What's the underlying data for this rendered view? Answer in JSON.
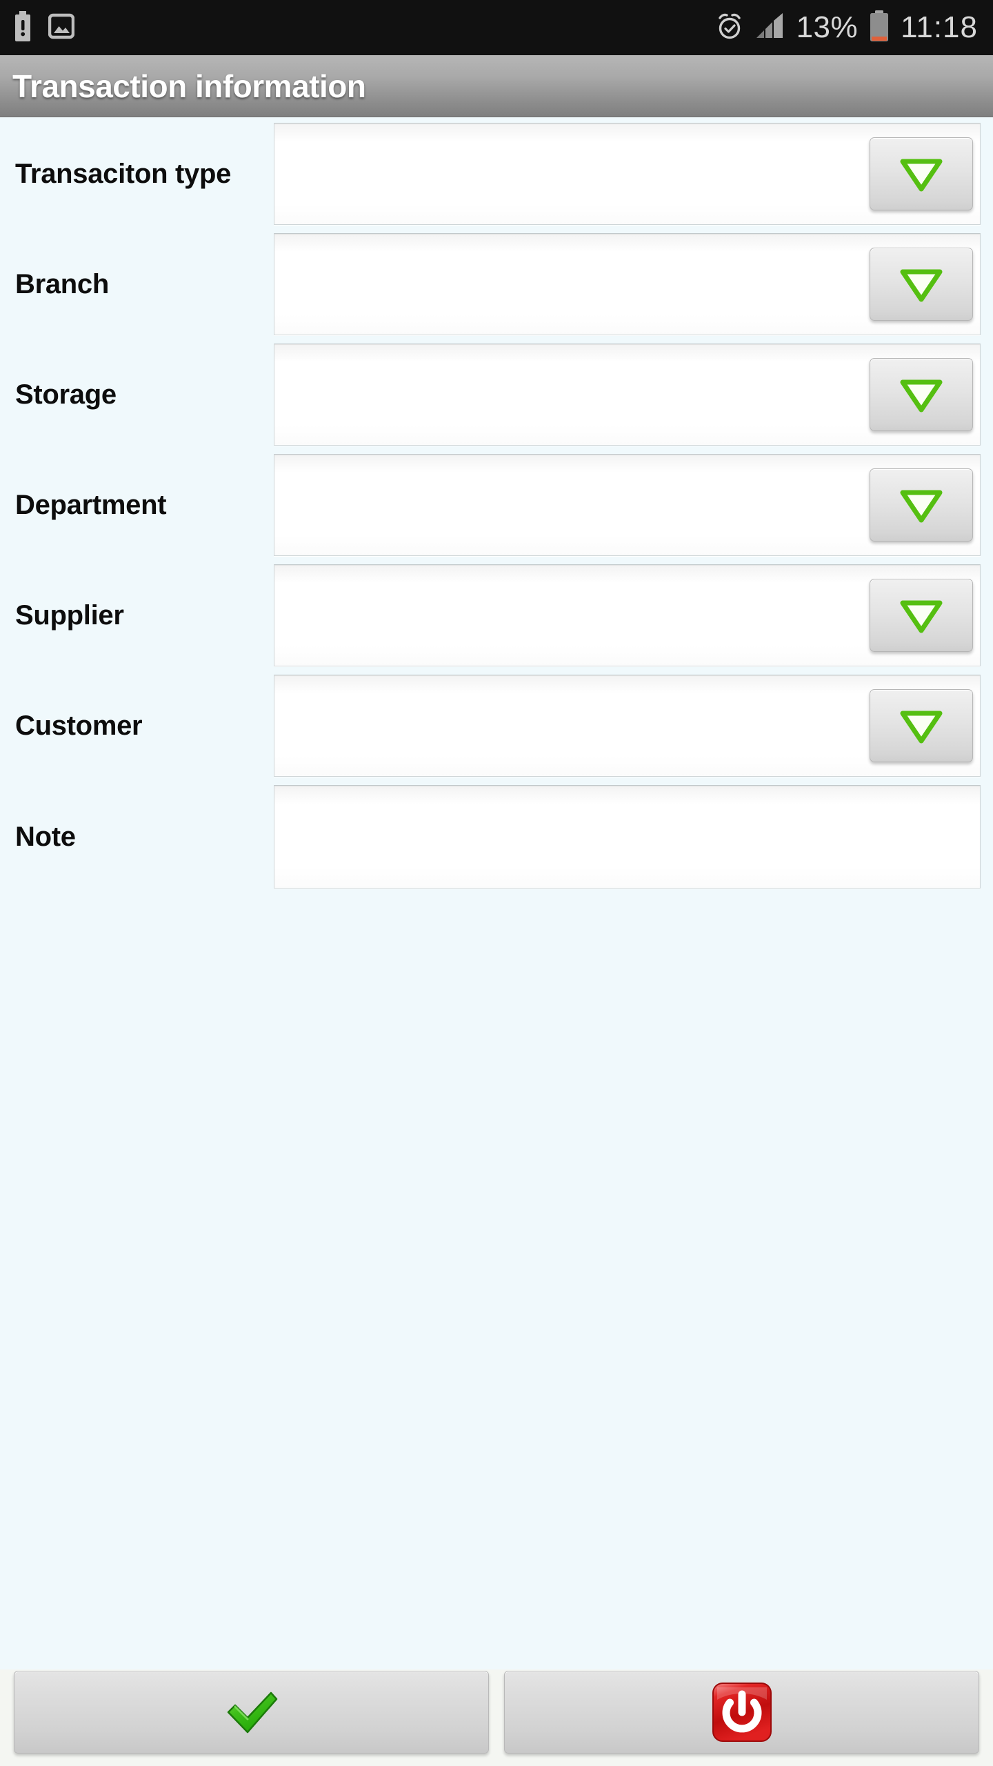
{
  "statusbar": {
    "left_icons": [
      {
        "name": "clipboard-alert-icon"
      },
      {
        "name": "image-icon"
      }
    ],
    "right_icons": [
      {
        "name": "alarm-clock-icon"
      },
      {
        "name": "signal-bars-icon"
      }
    ],
    "battery_percent": "13%",
    "battery_icon": "battery-low-icon",
    "clock": "11:18",
    "bg_color": "#111111",
    "text_color": "#d8d8d8",
    "battery_low_color": "#e0603a"
  },
  "titlebar": {
    "title": "Transaction information",
    "gradient_top": "#b6b6b6",
    "gradient_bottom": "#7f7f7f",
    "text_color": "#ffffff"
  },
  "form": {
    "background_color": "#f0f9fc",
    "label_color": "#0d0d0d",
    "dropdown_arrow_color": "#5cc11a",
    "rows": [
      {
        "label": "Transaciton type",
        "value": "",
        "placeholder": "",
        "has_dropdown": true,
        "name": "transaction-type"
      },
      {
        "label": "Branch",
        "value": "",
        "placeholder": "",
        "has_dropdown": true,
        "name": "branch"
      },
      {
        "label": "Storage",
        "value": "",
        "placeholder": "",
        "has_dropdown": true,
        "name": "storage"
      },
      {
        "label": "Department",
        "value": "",
        "placeholder": "",
        "has_dropdown": true,
        "name": "department"
      },
      {
        "label": "Supplier",
        "value": "",
        "placeholder": "",
        "has_dropdown": true,
        "name": "supplier"
      },
      {
        "label": "Customer",
        "value": "",
        "placeholder": "",
        "has_dropdown": true,
        "name": "customer"
      },
      {
        "label": "Note",
        "value": "",
        "placeholder": "",
        "has_dropdown": false,
        "name": "note"
      }
    ]
  },
  "bottombar": {
    "buttons": [
      {
        "name": "confirm-button",
        "icon": "green-checkmark-icon",
        "label": "",
        "color": "#3cb820"
      },
      {
        "name": "exit-button",
        "icon": "red-power-icon",
        "label": "",
        "color": "#d41717"
      }
    ]
  }
}
